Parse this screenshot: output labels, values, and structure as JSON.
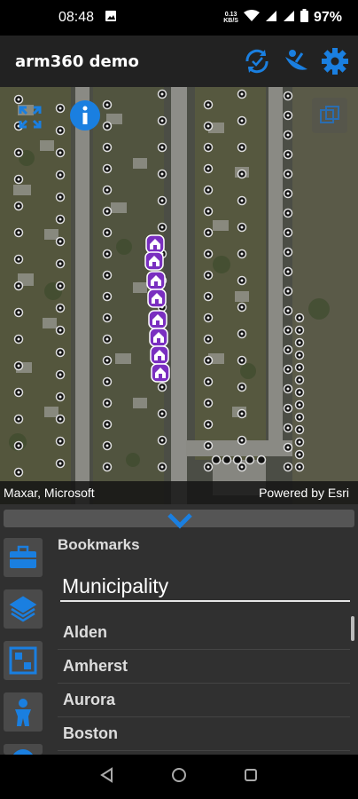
{
  "status_bar": {
    "time": "08:48",
    "net_speed_value": "0.13",
    "net_speed_unit": "KB/S",
    "battery": "97%"
  },
  "app_bar": {
    "title": "arm360 demo",
    "icons": [
      "sync-icon",
      "satellite-dish-icon",
      "settings-gear-icon"
    ]
  },
  "map": {
    "attribution_left": "Maxar, Microsoft",
    "attribution_right": "Powered by Esri",
    "controls": [
      "fullscreen-icon",
      "info-icon",
      "layer-toggle-icon"
    ]
  },
  "panel": {
    "section_title": "Bookmarks",
    "selected_option": "Municipality",
    "list": [
      "Alden",
      "Amherst",
      "Aurora",
      "Boston"
    ],
    "side_icons": [
      "briefcase-icon",
      "layers-icon",
      "contact-card-icon",
      "person-icon",
      "globe-icon"
    ]
  },
  "nav_bar": {
    "buttons": [
      "back-button",
      "home-button",
      "recents-button"
    ]
  },
  "colors": {
    "accent": "#1a7fe0",
    "marker_purple": "#7a2fc0",
    "panel_bg": "#303030"
  }
}
